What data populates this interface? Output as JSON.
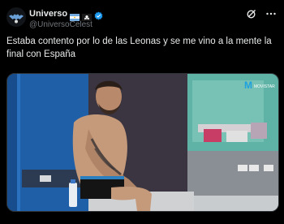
{
  "tweet": {
    "author": {
      "display_name": "Universo",
      "handle": "@UniversoCelest",
      "avatar_icon": "bat-logo-icon",
      "verified": true
    },
    "actions": {
      "grok_icon": "grok-icon",
      "more_icon": "more-icon"
    },
    "text": "Estaba contento por lo de las Leonas y se me vino a la mente la final con España",
    "media": {
      "type": "video-frame",
      "watermark_brand": "M",
      "watermark_text": "MOVISTAR"
    }
  },
  "colors": {
    "background": "#000000",
    "text": "#e7e9ea",
    "secondary_text": "#71767b",
    "verified": "#1d9bf0"
  }
}
